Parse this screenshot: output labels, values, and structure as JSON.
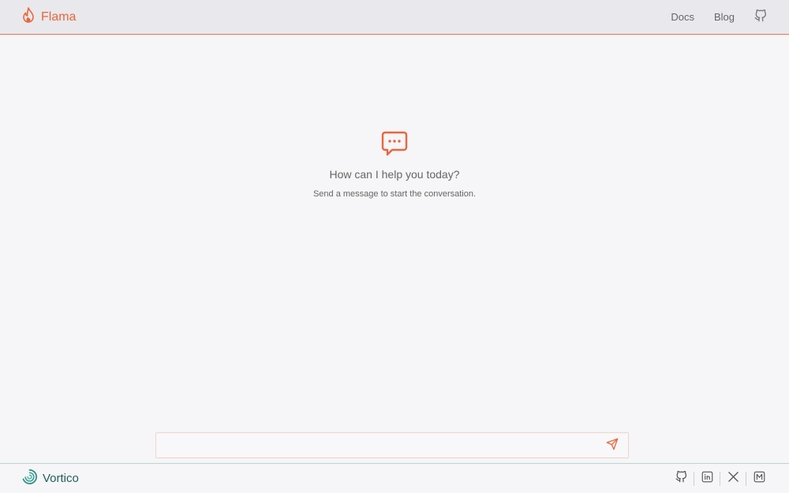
{
  "header": {
    "brand": "Flama",
    "nav": [
      {
        "label": "Docs"
      },
      {
        "label": "Blog"
      }
    ],
    "github_icon": "github-icon"
  },
  "empty_state": {
    "icon": "chat-bubble-icon",
    "title": "How can I help you today?",
    "subtitle": "Send a message to start the conversation."
  },
  "composer": {
    "value": "",
    "placeholder": "",
    "send_icon": "send-icon"
  },
  "footer": {
    "brand": "Vortico",
    "social": [
      "github-icon",
      "linkedin-icon",
      "x-icon",
      "medium-icon"
    ]
  },
  "colors": {
    "accent": "#e8673d",
    "footer_brand": "#1f5f5a",
    "background": "#f6f5f7",
    "header_bg": "#e9e8ec"
  }
}
